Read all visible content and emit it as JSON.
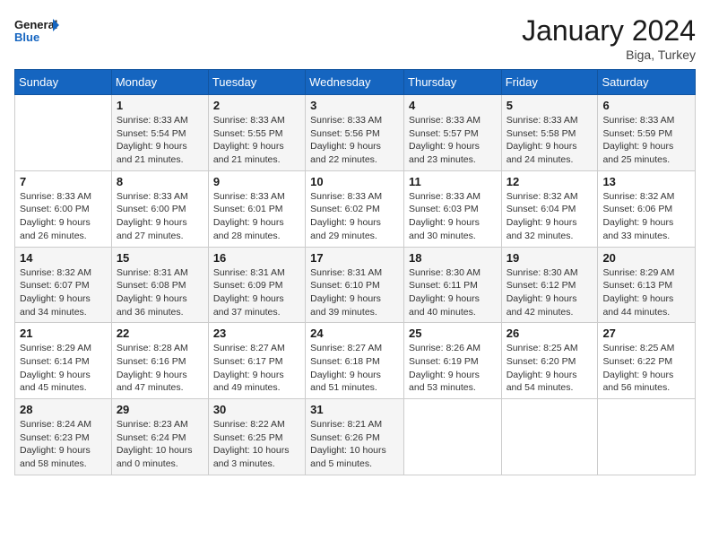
{
  "header": {
    "logo_line1": "General",
    "logo_line2": "Blue",
    "title": "January 2024",
    "subtitle": "Biga, Turkey"
  },
  "weekdays": [
    "Sunday",
    "Monday",
    "Tuesday",
    "Wednesday",
    "Thursday",
    "Friday",
    "Saturday"
  ],
  "weeks": [
    [
      {
        "day": "",
        "info": ""
      },
      {
        "day": "1",
        "info": "Sunrise: 8:33 AM\nSunset: 5:54 PM\nDaylight: 9 hours\nand 21 minutes."
      },
      {
        "day": "2",
        "info": "Sunrise: 8:33 AM\nSunset: 5:55 PM\nDaylight: 9 hours\nand 21 minutes."
      },
      {
        "day": "3",
        "info": "Sunrise: 8:33 AM\nSunset: 5:56 PM\nDaylight: 9 hours\nand 22 minutes."
      },
      {
        "day": "4",
        "info": "Sunrise: 8:33 AM\nSunset: 5:57 PM\nDaylight: 9 hours\nand 23 minutes."
      },
      {
        "day": "5",
        "info": "Sunrise: 8:33 AM\nSunset: 5:58 PM\nDaylight: 9 hours\nand 24 minutes."
      },
      {
        "day": "6",
        "info": "Sunrise: 8:33 AM\nSunset: 5:59 PM\nDaylight: 9 hours\nand 25 minutes."
      }
    ],
    [
      {
        "day": "7",
        "info": "Sunrise: 8:33 AM\nSunset: 6:00 PM\nDaylight: 9 hours\nand 26 minutes."
      },
      {
        "day": "8",
        "info": "Sunrise: 8:33 AM\nSunset: 6:00 PM\nDaylight: 9 hours\nand 27 minutes."
      },
      {
        "day": "9",
        "info": "Sunrise: 8:33 AM\nSunset: 6:01 PM\nDaylight: 9 hours\nand 28 minutes."
      },
      {
        "day": "10",
        "info": "Sunrise: 8:33 AM\nSunset: 6:02 PM\nDaylight: 9 hours\nand 29 minutes."
      },
      {
        "day": "11",
        "info": "Sunrise: 8:33 AM\nSunset: 6:03 PM\nDaylight: 9 hours\nand 30 minutes."
      },
      {
        "day": "12",
        "info": "Sunrise: 8:32 AM\nSunset: 6:04 PM\nDaylight: 9 hours\nand 32 minutes."
      },
      {
        "day": "13",
        "info": "Sunrise: 8:32 AM\nSunset: 6:06 PM\nDaylight: 9 hours\nand 33 minutes."
      }
    ],
    [
      {
        "day": "14",
        "info": "Sunrise: 8:32 AM\nSunset: 6:07 PM\nDaylight: 9 hours\nand 34 minutes."
      },
      {
        "day": "15",
        "info": "Sunrise: 8:31 AM\nSunset: 6:08 PM\nDaylight: 9 hours\nand 36 minutes."
      },
      {
        "day": "16",
        "info": "Sunrise: 8:31 AM\nSunset: 6:09 PM\nDaylight: 9 hours\nand 37 minutes."
      },
      {
        "day": "17",
        "info": "Sunrise: 8:31 AM\nSunset: 6:10 PM\nDaylight: 9 hours\nand 39 minutes."
      },
      {
        "day": "18",
        "info": "Sunrise: 8:30 AM\nSunset: 6:11 PM\nDaylight: 9 hours\nand 40 minutes."
      },
      {
        "day": "19",
        "info": "Sunrise: 8:30 AM\nSunset: 6:12 PM\nDaylight: 9 hours\nand 42 minutes."
      },
      {
        "day": "20",
        "info": "Sunrise: 8:29 AM\nSunset: 6:13 PM\nDaylight: 9 hours\nand 44 minutes."
      }
    ],
    [
      {
        "day": "21",
        "info": "Sunrise: 8:29 AM\nSunset: 6:14 PM\nDaylight: 9 hours\nand 45 minutes."
      },
      {
        "day": "22",
        "info": "Sunrise: 8:28 AM\nSunset: 6:16 PM\nDaylight: 9 hours\nand 47 minutes."
      },
      {
        "day": "23",
        "info": "Sunrise: 8:27 AM\nSunset: 6:17 PM\nDaylight: 9 hours\nand 49 minutes."
      },
      {
        "day": "24",
        "info": "Sunrise: 8:27 AM\nSunset: 6:18 PM\nDaylight: 9 hours\nand 51 minutes."
      },
      {
        "day": "25",
        "info": "Sunrise: 8:26 AM\nSunset: 6:19 PM\nDaylight: 9 hours\nand 53 minutes."
      },
      {
        "day": "26",
        "info": "Sunrise: 8:25 AM\nSunset: 6:20 PM\nDaylight: 9 hours\nand 54 minutes."
      },
      {
        "day": "27",
        "info": "Sunrise: 8:25 AM\nSunset: 6:22 PM\nDaylight: 9 hours\nand 56 minutes."
      }
    ],
    [
      {
        "day": "28",
        "info": "Sunrise: 8:24 AM\nSunset: 6:23 PM\nDaylight: 9 hours\nand 58 minutes."
      },
      {
        "day": "29",
        "info": "Sunrise: 8:23 AM\nSunset: 6:24 PM\nDaylight: 10 hours\nand 0 minutes."
      },
      {
        "day": "30",
        "info": "Sunrise: 8:22 AM\nSunset: 6:25 PM\nDaylight: 10 hours\nand 3 minutes."
      },
      {
        "day": "31",
        "info": "Sunrise: 8:21 AM\nSunset: 6:26 PM\nDaylight: 10 hours\nand 5 minutes."
      },
      {
        "day": "",
        "info": ""
      },
      {
        "day": "",
        "info": ""
      },
      {
        "day": "",
        "info": ""
      }
    ]
  ]
}
